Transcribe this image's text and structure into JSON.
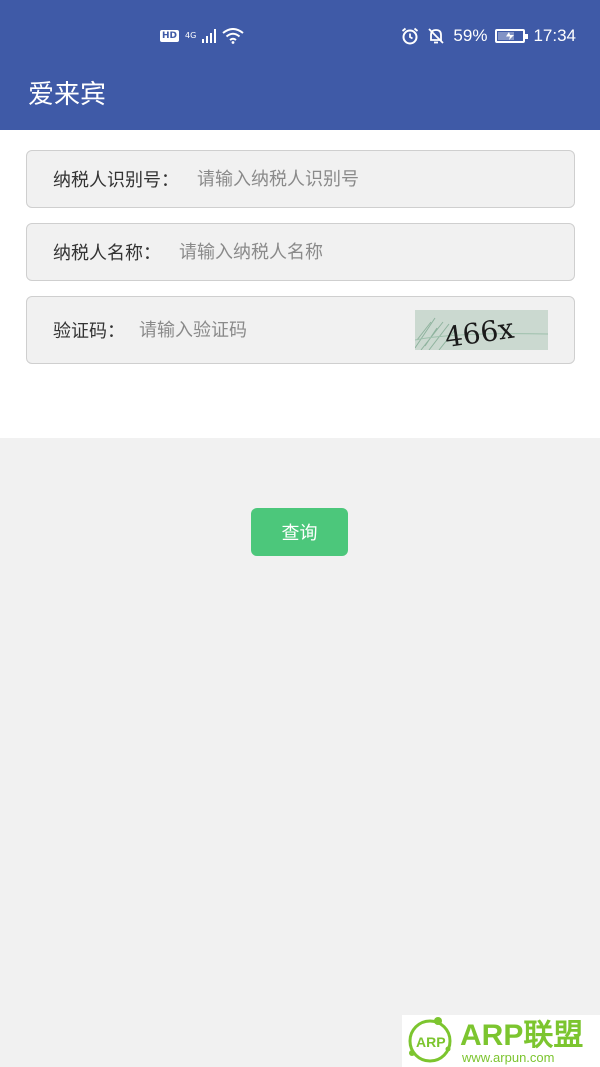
{
  "status_bar": {
    "network_hd": "HD",
    "network_type": "4G",
    "battery": "59%",
    "time": "17:34",
    "battery_level": 0.59
  },
  "app": {
    "title": "爱来宾"
  },
  "form": {
    "taxpayer_id": {
      "label": "纳税人识别号：",
      "placeholder": "请输入纳税人识别号",
      "value": ""
    },
    "taxpayer_name": {
      "label": "纳税人名称：",
      "placeholder": "请输入纳税人名称",
      "value": ""
    },
    "captcha": {
      "label": "验证码：",
      "placeholder": "请输入验证码",
      "value": "",
      "image_text": "466x"
    },
    "query_label": "查询"
  },
  "watermark": {
    "brand": "ARP联盟",
    "url": "www.arpun.com",
    "badge": "ARP"
  },
  "colors": {
    "header": "#3f5aa7",
    "button": "#4cc77b",
    "watermark": "#7cc52f"
  }
}
